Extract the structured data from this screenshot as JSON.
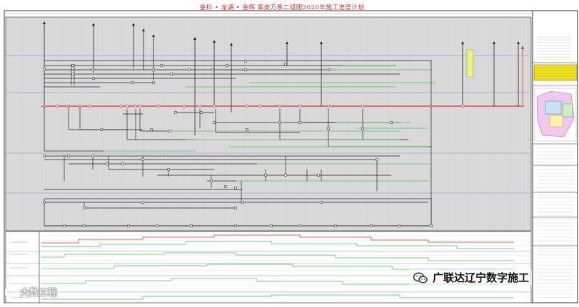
{
  "title": "金科 • 龙湖 • 金辉  集美万象二组团2020年施工进度计划",
  "watermark_left": "大数工程",
  "watermark_right": "广联达辽宁数字施工",
  "colors": {
    "critical_path": "#e0302a",
    "float_line": "#4cc44c",
    "activity_line": "#222222",
    "grid_line": "#7d8fd6",
    "schedule_bg": "#d9d9d9",
    "title": "#d0342c"
  },
  "icons": [
    "wechat-icon",
    "face-icon"
  ]
}
